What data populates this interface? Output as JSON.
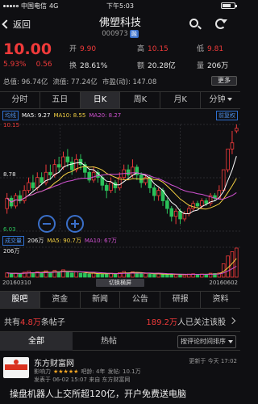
{
  "status": {
    "carrier": "中国电信",
    "network": "4G",
    "time": "下午5:03"
  },
  "nav": {
    "back_label": "返回",
    "title": "佛塑科技",
    "code": "000973",
    "rong_tag": "融"
  },
  "quote": {
    "price": "10.00",
    "change_pct": "5.93%",
    "change": "0.56",
    "open_label": "开",
    "open": "9.90",
    "high_label": "高",
    "high": "10.15",
    "chg_label": "换",
    "turnover_rate": "28.61%",
    "amt_label": "额",
    "amount": "20.28亿",
    "low_label": "低",
    "low": "9.81",
    "vol_label": "量",
    "volume": "206万",
    "total_mv": "总值: 96.74亿",
    "float_mv": "流值: 77.24亿",
    "pe": "市盈(动): 147.08",
    "more_label": "更多"
  },
  "period_tabs": [
    "分时",
    "五日",
    "日K",
    "周K",
    "月K",
    "分钟"
  ],
  "active_period": 2,
  "ma": {
    "tag": "均线",
    "ma5": "MA5: 9.27",
    "ma10": "MA10: 8.55",
    "ma20": "MA20: 8.27",
    "fq_label": "前复权",
    "colors": {
      "ma5": "#ffffff",
      "ma10": "#f5d142",
      "ma20": "#d252d2"
    }
  },
  "axis": {
    "top": "10.15",
    "mid": "8.78",
    "bottom": "6.03"
  },
  "volume": {
    "tag": "成交量",
    "value": "206万",
    "ma5": "MA5: 90.7万",
    "ma10": "MA10: 67万",
    "axis_top": "206万",
    "colors": {
      "ma5": "#f5d142",
      "ma10": "#d252d2"
    }
  },
  "dates": {
    "start": "20160310",
    "end": "20160602",
    "switch_label": "切换横屏"
  },
  "bottom_tabs": [
    "股吧",
    "资金",
    "新闻",
    "公告",
    "研报",
    "资料"
  ],
  "active_bottom": 0,
  "forum": {
    "posts_prefix": "共有",
    "posts_count": "4.8万",
    "posts_suffix": "条帖子",
    "followers_count": "189.2万",
    "followers_suffix": "人已关注该股",
    "filter_all": "全部",
    "filter_hot": "热帖",
    "sort_label": "按评论时间排序"
  },
  "post": {
    "author": "东方财富网",
    "influence_label": "影响力",
    "stars": "★★★★★",
    "age": "吧龄: 4年",
    "post_count": "发帖: 10.1万",
    "time_info": "发表于 06-02 15:07  来自 东方财富网",
    "updated": "更新于 今天 17:02",
    "headline": "操盘机器人上交所超120亿，开户免费送电脑"
  },
  "chart_data": {
    "type": "candlestick",
    "title": "",
    "xlabel": "",
    "ylabel": "",
    "ylim": [
      6.03,
      10.15
    ],
    "x_range": [
      "20160310",
      "20160602"
    ],
    "candles_approx": [
      {
        "o": 6.9,
        "c": 7.3,
        "h": 7.5,
        "l": 6.7
      },
      {
        "o": 7.3,
        "c": 7.0,
        "h": 7.4,
        "l": 6.9
      },
      {
        "o": 7.0,
        "c": 7.4,
        "h": 7.5,
        "l": 6.9
      },
      {
        "o": 7.4,
        "c": 7.2,
        "h": 7.6,
        "l": 7.1
      },
      {
        "o": 7.2,
        "c": 7.6,
        "h": 7.8,
        "l": 7.1
      },
      {
        "o": 7.6,
        "c": 7.9,
        "h": 8.1,
        "l": 7.5
      },
      {
        "o": 7.9,
        "c": 7.7,
        "h": 8.2,
        "l": 7.6
      },
      {
        "o": 7.7,
        "c": 8.1,
        "h": 8.3,
        "l": 7.6
      },
      {
        "o": 8.1,
        "c": 7.9,
        "h": 8.3,
        "l": 7.8
      },
      {
        "o": 7.9,
        "c": 8.3,
        "h": 8.6,
        "l": 7.8
      },
      {
        "o": 8.3,
        "c": 8.2,
        "h": 8.6,
        "l": 8.0
      },
      {
        "o": 8.2,
        "c": 8.6,
        "h": 8.8,
        "l": 8.1
      },
      {
        "o": 8.6,
        "c": 8.5,
        "h": 8.9,
        "l": 8.3
      },
      {
        "o": 8.5,
        "c": 8.9,
        "h": 9.1,
        "l": 8.4
      },
      {
        "o": 8.9,
        "c": 8.7,
        "h": 9.2,
        "l": 8.5
      },
      {
        "o": 8.7,
        "c": 8.4,
        "h": 8.9,
        "l": 8.2
      },
      {
        "o": 8.4,
        "c": 8.8,
        "h": 9.0,
        "l": 8.3
      },
      {
        "o": 8.8,
        "c": 8.6,
        "h": 9.0,
        "l": 8.4
      },
      {
        "o": 8.6,
        "c": 8.3,
        "h": 8.7,
        "l": 8.1
      },
      {
        "o": 8.3,
        "c": 8.0,
        "h": 8.4,
        "l": 7.9
      },
      {
        "o": 8.0,
        "c": 8.3,
        "h": 8.5,
        "l": 7.9
      },
      {
        "o": 8.3,
        "c": 8.1,
        "h": 8.4,
        "l": 7.9
      },
      {
        "o": 8.1,
        "c": 7.8,
        "h": 8.2,
        "l": 7.6
      },
      {
        "o": 7.8,
        "c": 7.6,
        "h": 7.9,
        "l": 7.3
      },
      {
        "o": 7.6,
        "c": 7.9,
        "h": 8.1,
        "l": 7.5
      },
      {
        "o": 7.9,
        "c": 7.7,
        "h": 8.0,
        "l": 7.5
      },
      {
        "o": 7.7,
        "c": 8.1,
        "h": 8.3,
        "l": 7.6
      },
      {
        "o": 8.1,
        "c": 8.4,
        "h": 8.6,
        "l": 8.0
      },
      {
        "o": 8.4,
        "c": 8.2,
        "h": 8.6,
        "l": 8.0
      },
      {
        "o": 8.2,
        "c": 8.5,
        "h": 8.8,
        "l": 8.1
      },
      {
        "o": 8.5,
        "c": 8.2,
        "h": 8.6,
        "l": 8.0
      },
      {
        "o": 8.2,
        "c": 7.9,
        "h": 8.3,
        "l": 7.7
      },
      {
        "o": 7.9,
        "c": 8.1,
        "h": 8.2,
        "l": 7.8
      },
      {
        "o": 8.1,
        "c": 7.7,
        "h": 8.2,
        "l": 7.5
      },
      {
        "o": 7.7,
        "c": 7.4,
        "h": 7.8,
        "l": 7.2
      },
      {
        "o": 7.4,
        "c": 7.6,
        "h": 7.7,
        "l": 7.2
      },
      {
        "o": 7.6,
        "c": 7.2,
        "h": 7.7,
        "l": 7.0
      },
      {
        "o": 7.2,
        "c": 6.9,
        "h": 7.3,
        "l": 6.7
      },
      {
        "o": 6.9,
        "c": 6.6,
        "h": 7.0,
        "l": 6.4
      },
      {
        "o": 6.6,
        "c": 6.8,
        "h": 6.9,
        "l": 6.3
      },
      {
        "o": 6.8,
        "c": 6.5,
        "h": 6.9,
        "l": 6.3
      },
      {
        "o": 6.5,
        "c": 6.7,
        "h": 6.8,
        "l": 6.4
      },
      {
        "o": 6.7,
        "c": 6.9,
        "h": 7.0,
        "l": 6.6
      },
      {
        "o": 6.9,
        "c": 7.1,
        "h": 7.2,
        "l": 6.8
      },
      {
        "o": 7.1,
        "c": 7.0,
        "h": 7.2,
        "l": 6.9
      },
      {
        "o": 7.0,
        "c": 7.2,
        "h": 7.3,
        "l": 6.9
      },
      {
        "o": 7.2,
        "c": 7.1,
        "h": 7.3,
        "l": 7.0
      },
      {
        "o": 7.1,
        "c": 7.4,
        "h": 7.5,
        "l": 7.0
      },
      {
        "o": 7.4,
        "c": 7.3,
        "h": 7.5,
        "l": 7.2
      },
      {
        "o": 7.3,
        "c": 7.6,
        "h": 7.8,
        "l": 7.3
      },
      {
        "o": 7.6,
        "c": 8.4,
        "h": 8.4,
        "l": 7.6
      },
      {
        "o": 8.4,
        "c": 9.2,
        "h": 9.2,
        "l": 8.3
      },
      {
        "o": 9.2,
        "c": 9.44,
        "h": 9.9,
        "l": 9.0
      },
      {
        "o": 9.9,
        "c": 10.0,
        "h": 10.15,
        "l": 9.81
      }
    ],
    "volume_approx": [
      30,
      25,
      28,
      22,
      35,
      42,
      30,
      38,
      28,
      45,
      32,
      48,
      35,
      52,
      40,
      30,
      38,
      28,
      26,
      22,
      30,
      24,
      20,
      26,
      28,
      22,
      32,
      40,
      30,
      38,
      28,
      24,
      26,
      22,
      20,
      24,
      20,
      18,
      22,
      18,
      20,
      16,
      22,
      24,
      18,
      22,
      18,
      28,
      26,
      30,
      95,
      150,
      180,
      206
    ]
  }
}
